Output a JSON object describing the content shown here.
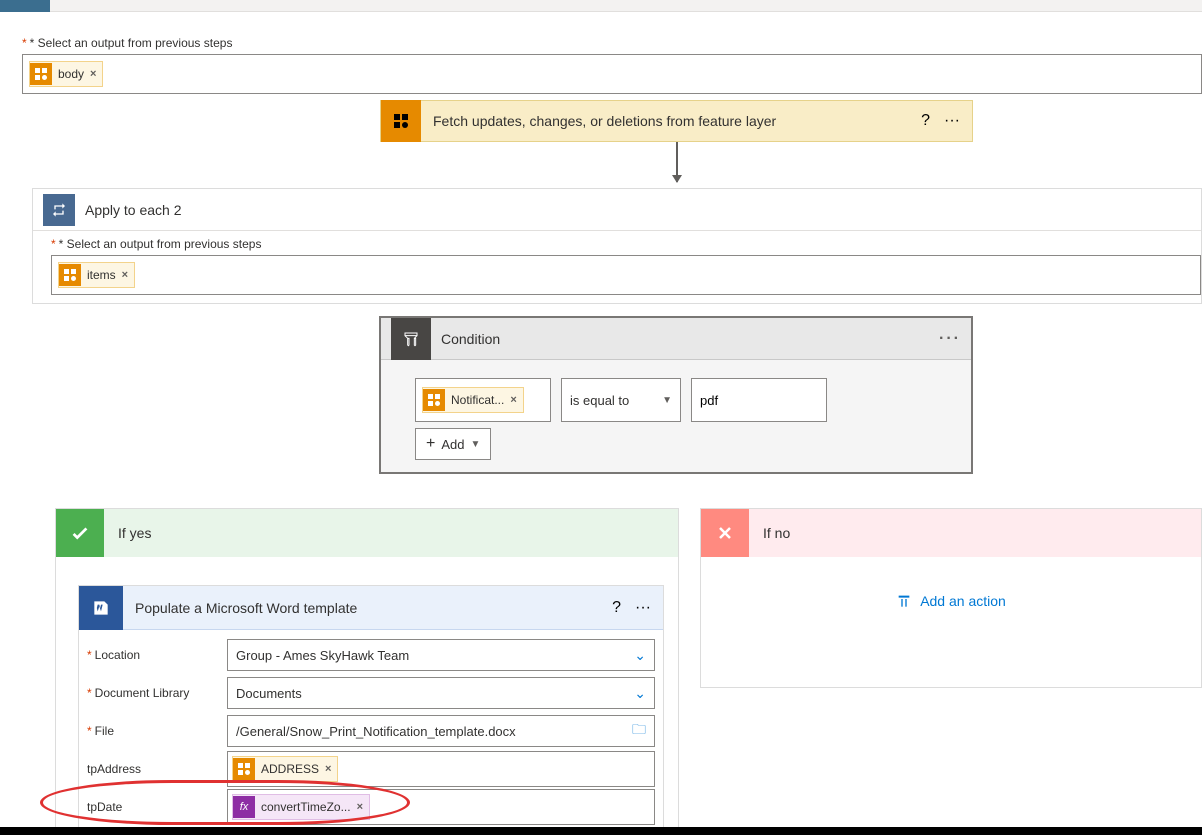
{
  "outer_loop": {
    "label": "* Select an output from previous steps",
    "token": "body"
  },
  "fetch": {
    "title": "Fetch updates, changes, or deletions from feature layer"
  },
  "inner_loop": {
    "title": "Apply to each 2",
    "label": "* Select an output from previous steps",
    "token": "items"
  },
  "condition": {
    "title": "Condition",
    "lhs_token": "Notificat...",
    "operator": "is equal to",
    "rhs": "pdf",
    "add": "Add"
  },
  "branches": {
    "yes": "If yes",
    "no": "If no",
    "add_action": "Add an action"
  },
  "word": {
    "title": "Populate a Microsoft Word template",
    "location_lbl": "Location",
    "location_val": "Group - Ames SkyHawk Team",
    "library_lbl": "Document Library",
    "library_val": "Documents",
    "file_lbl": "File",
    "file_val": "/General/Snow_Print_Notification_template.docx",
    "addr_lbl": "tpAddress",
    "addr_token": "ADDRESS",
    "date_lbl": "tpDate",
    "date_token": "convertTimeZo..."
  },
  "glyphs": {
    "x": "×"
  }
}
